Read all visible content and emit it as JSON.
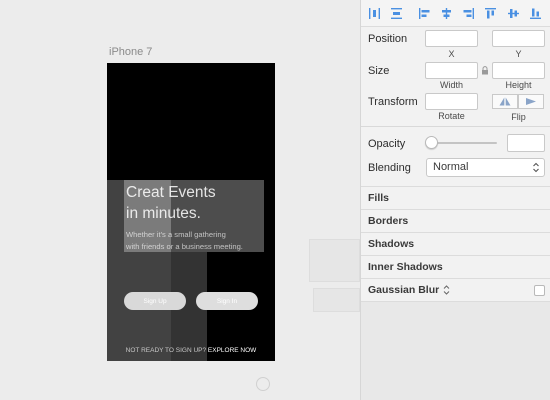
{
  "canvas": {
    "artboard_label": "iPhone 7",
    "headline_line1": "Creat Events",
    "headline_line2": "in minutes.",
    "subline_line1": "Whether it's a small gathering",
    "subline_line2": "with friends or a business meeting.",
    "signup_button": "Sign Up",
    "signin_button": "Sign In",
    "footer_text": "NOT READY TO SIGN UP?",
    "footer_link": "EXPLORE NOW"
  },
  "inspector": {
    "position_label": "Position",
    "x_caption": "X",
    "y_caption": "Y",
    "size_label": "Size",
    "width_caption": "Width",
    "height_caption": "Height",
    "transform_label": "Transform",
    "rotate_caption": "Rotate",
    "flip_caption": "Flip",
    "opacity_label": "Opacity",
    "opacity_value": 0,
    "blending_label": "Blending",
    "blending_value": "Normal",
    "sections": {
      "fills": "Fills",
      "borders": "Borders",
      "shadows": "Shadows",
      "inner_shadows": "Inner Shadows",
      "gaussian_blur": "Gaussian Blur"
    },
    "gaussian_blur_checked": false
  },
  "toolbar_icons": [
    "distribute-horizontal-icon",
    "distribute-vertical-icon",
    "align-left-icon",
    "align-center-horizontal-icon",
    "align-right-icon",
    "align-top-icon",
    "align-middle-vertical-icon",
    "align-bottom-icon"
  ],
  "colors": {
    "accent": "#4a90e2",
    "artboard_bg": "#000000",
    "canvas_bg": "#ececec",
    "inspector_bg": "#f2f2f2"
  }
}
